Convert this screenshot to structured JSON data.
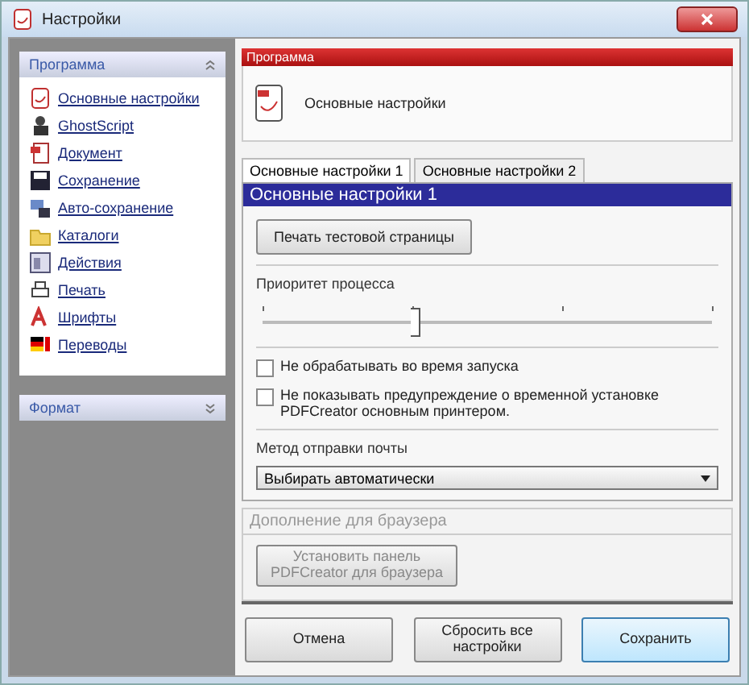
{
  "window": {
    "title": "Настройки"
  },
  "sidebar": {
    "sections": [
      {
        "title": "Программа",
        "expanded": true,
        "items": [
          {
            "label": "Основные настройки",
            "kind": "app"
          },
          {
            "label": "GhostScript",
            "kind": "ghost"
          },
          {
            "label": "Документ",
            "kind": "doc"
          },
          {
            "label": "Сохранение",
            "kind": "disk"
          },
          {
            "label": "Авто-сохранение",
            "kind": "auto"
          },
          {
            "label": "Каталоги",
            "kind": "folder"
          },
          {
            "label": "Действия",
            "kind": "actions"
          },
          {
            "label": "Печать",
            "kind": "printer"
          },
          {
            "label": "Шрифты",
            "kind": "fonts"
          },
          {
            "label": "Переводы",
            "kind": "flag"
          }
        ]
      },
      {
        "title": "Формат",
        "expanded": false
      }
    ]
  },
  "content": {
    "section_bar": "Программа",
    "heading": "Основные настройки",
    "tabs": [
      {
        "label": "Основные настройки 1",
        "selected": true
      },
      {
        "label": "Основные настройки 2",
        "selected": false
      }
    ],
    "panel_title": "Основные настройки 1",
    "test_page_button": "Печать тестовой страницы",
    "priority": {
      "label": "Приоритет процесса",
      "level": 0.34
    },
    "checkboxes": [
      {
        "label": "Не обрабатывать во время запуска",
        "checked": false
      },
      {
        "label": "Не показывать предупреждение о временной установке PDFCreator основным принтером.",
        "checked": false
      }
    ],
    "mail": {
      "label": "Метод отправки почты",
      "value": "Выбирать автоматически"
    },
    "browser": {
      "title": "Дополнение для браузера",
      "button": "Установить панель PDFCreator для браузера",
      "disabled": true
    }
  },
  "buttons": [
    {
      "label": "Отмена",
      "default": false
    },
    {
      "label": "Сбросить все настройки",
      "default": false
    },
    {
      "label": "Сохранить",
      "default": true
    }
  ]
}
